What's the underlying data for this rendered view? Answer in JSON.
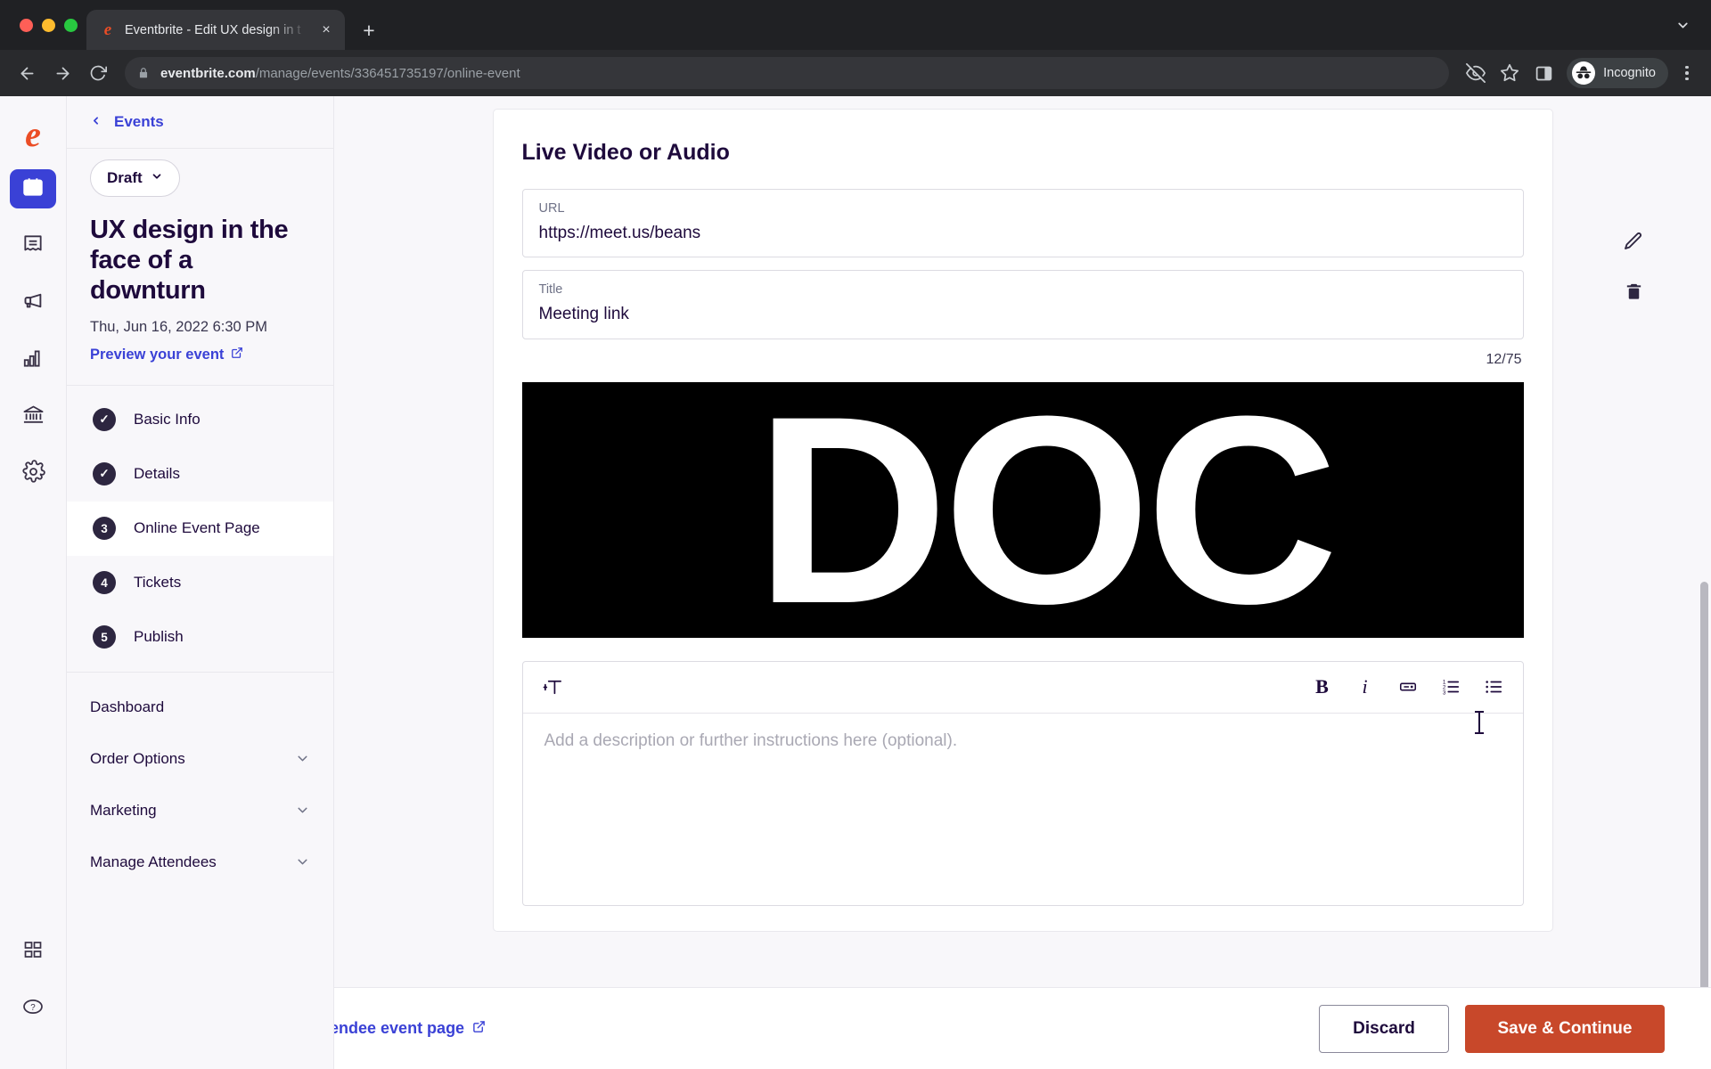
{
  "browser": {
    "tab": {
      "title": "Eventbrite - Edit UX design in t",
      "favicon": "eventbrite-e-icon",
      "close": "×"
    },
    "newtab_label": "+",
    "url_host": "eventbrite.com",
    "url_path": "/manage/events/336451735197/online-event",
    "profile_label": "Incognito",
    "icons": {
      "back": "back-arrow-icon",
      "forward": "forward-arrow-icon",
      "reload": "reload-icon",
      "lock": "lock-icon",
      "tracking": "eye-off-icon",
      "bookmark": "star-icon",
      "sidepanel": "side-panel-icon",
      "menu": "kebab-menu-icon",
      "tablist": "chevron-down-icon"
    }
  },
  "rail": {
    "logo": "eventbrite-logo",
    "items": [
      {
        "name": "events",
        "icon": "calendar-icon",
        "active": true
      },
      {
        "name": "orders",
        "icon": "receipt-icon",
        "active": false
      },
      {
        "name": "marketing",
        "icon": "megaphone-icon",
        "active": false
      },
      {
        "name": "reports",
        "icon": "bar-chart-icon",
        "active": false
      },
      {
        "name": "finance",
        "icon": "bank-icon",
        "active": false
      },
      {
        "name": "settings",
        "icon": "gear-icon",
        "active": false
      }
    ],
    "bottom": [
      {
        "name": "apps",
        "icon": "grid-apps-icon"
      },
      {
        "name": "help",
        "icon": "help-circle-icon"
      }
    ]
  },
  "sidebar": {
    "back_label": "Events",
    "status": "Draft",
    "event_title": "UX design in the face of a downturn",
    "event_date": "Thu, Jun 16, 2022 6:30 PM",
    "preview_label": "Preview your event",
    "steps": [
      {
        "badge": "✓",
        "label": "Basic Info",
        "active": false
      },
      {
        "badge": "✓",
        "label": "Details",
        "active": false
      },
      {
        "badge": "3",
        "label": "Online Event Page",
        "active": true
      },
      {
        "badge": "4",
        "label": "Tickets",
        "active": false
      },
      {
        "badge": "5",
        "label": "Publish",
        "active": false
      }
    ],
    "links": [
      {
        "label": "Dashboard",
        "chevron": false
      },
      {
        "label": "Order Options",
        "chevron": true
      },
      {
        "label": "Marketing",
        "chevron": true
      },
      {
        "label": "Manage Attendees",
        "chevron": true
      }
    ]
  },
  "main": {
    "card_title": "Live Video or Audio",
    "url_field": {
      "label": "URL",
      "value": "https://meet.us/beans"
    },
    "title_field": {
      "label": "Title",
      "value": "Meeting link"
    },
    "counter": "12/75",
    "media": {
      "alt": "DOC",
      "text": "DOC"
    },
    "editor": {
      "format_icon": "text-format-icon",
      "bold": "B",
      "italic": "i",
      "link_icon": "link-icon",
      "ordered_list_icon": "ordered-list-icon",
      "bullet_list_icon": "bullet-list-icon",
      "placeholder": "Add a description or further instructions here (optional)."
    },
    "side_actions": [
      {
        "name": "edit",
        "icon": "pencil-icon"
      },
      {
        "name": "delete",
        "icon": "trash-icon"
      }
    ]
  },
  "footer": {
    "link_label": "ew attendee event page",
    "discard_label": "Discard",
    "save_label": "Save & Continue"
  },
  "colors": {
    "brand_orange": "#eb4d26",
    "accent_blue": "#3a41d6",
    "dark_purple": "#1e0a3c",
    "save_red": "#c8482a"
  }
}
